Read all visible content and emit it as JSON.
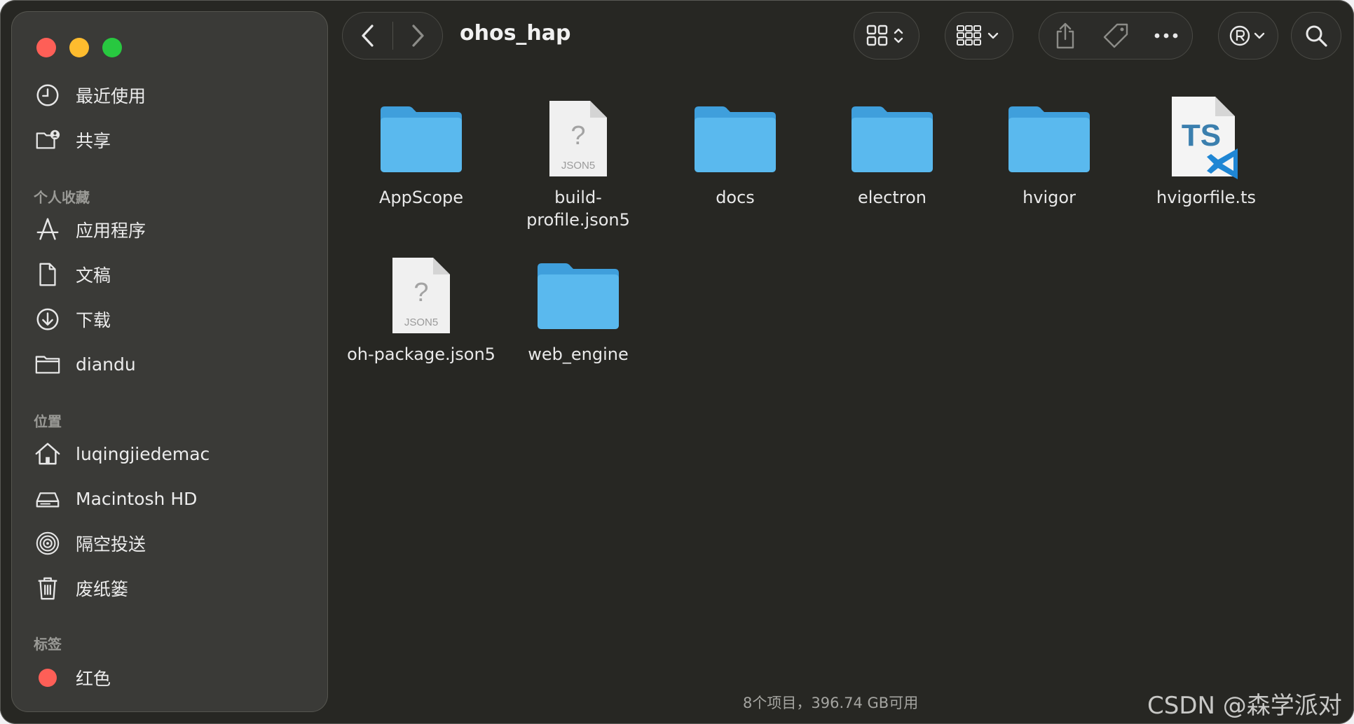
{
  "window": {
    "title": "ohos_hap",
    "colors": {
      "background": "#272723",
      "sidebar": "#3a3a37",
      "folder": "#5ab4ec",
      "tag_red": "#fe5f57"
    }
  },
  "sidebar": {
    "recents": {
      "label": "最近使用",
      "icon": "clock-icon"
    },
    "shared": {
      "label": "共享",
      "icon": "shared-folder-icon"
    },
    "favorites_header": "个人收藏",
    "favorites": [
      {
        "label": "应用程序",
        "icon": "apps-icon"
      },
      {
        "label": "文稿",
        "icon": "document-icon"
      },
      {
        "label": "下载",
        "icon": "download-icon"
      },
      {
        "label": "diandu",
        "icon": "folder-icon"
      }
    ],
    "locations_header": "位置",
    "locations": [
      {
        "label": "luqingjiedemac",
        "icon": "home-icon"
      },
      {
        "label": "Macintosh HD",
        "icon": "drive-icon"
      },
      {
        "label": "隔空投送",
        "icon": "airdrop-icon"
      },
      {
        "label": "废纸篓",
        "icon": "trash-icon"
      }
    ],
    "tags_header": "标签",
    "tags": [
      {
        "label": "红色",
        "color": "#fe5f57"
      }
    ]
  },
  "files": [
    {
      "name": "AppScope",
      "type": "folder"
    },
    {
      "name": "build-profile.json5",
      "line1": "build-",
      "line2": "profile.json5",
      "type": "json5",
      "badge": "JSON5"
    },
    {
      "name": "docs",
      "type": "folder"
    },
    {
      "name": "electron",
      "type": "folder"
    },
    {
      "name": "hvigor",
      "type": "folder"
    },
    {
      "name": "hvigorfile.ts",
      "type": "ts",
      "badge": "TS"
    },
    {
      "name": "oh-package.json5",
      "type": "json5",
      "badge": "JSON5"
    },
    {
      "name": "web_engine",
      "type": "folder"
    }
  ],
  "status": "8个项目，396.74 GB可用",
  "watermark": "CSDN @森学派对"
}
